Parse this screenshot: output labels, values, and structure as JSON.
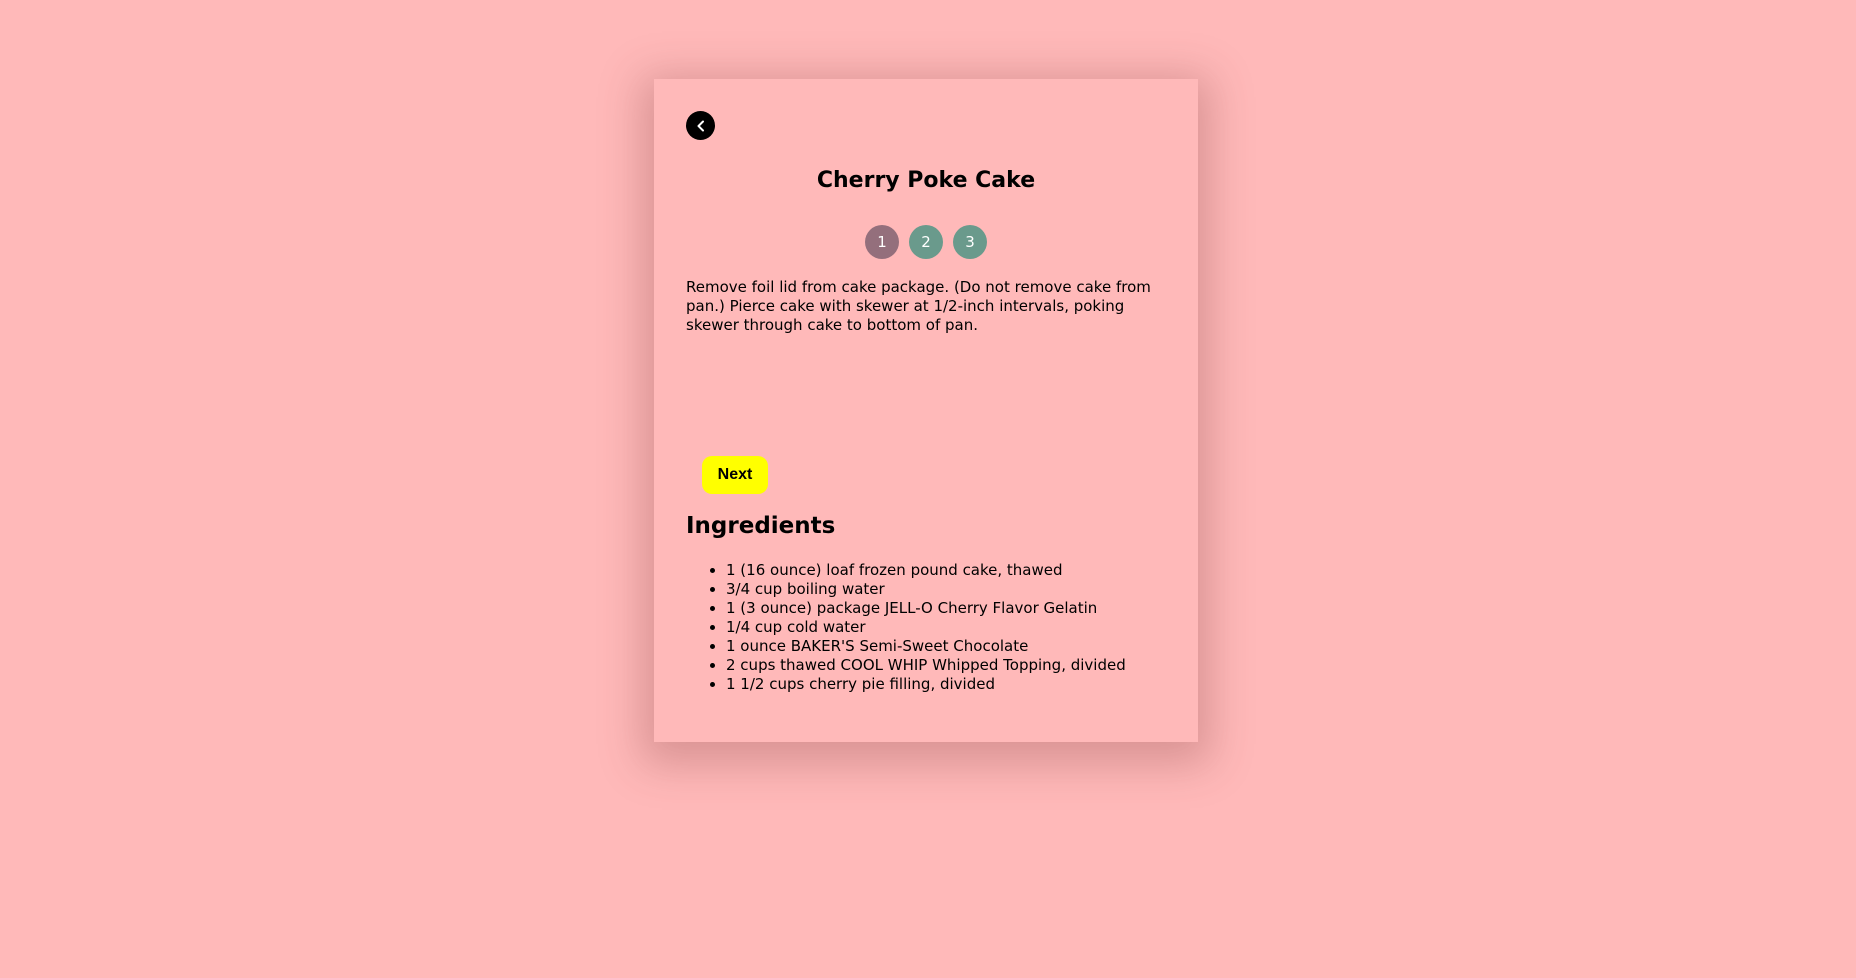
{
  "recipe": {
    "title": "Cherry Poke Cake"
  },
  "steps": {
    "items": [
      "1",
      "2",
      "3"
    ],
    "active": 1,
    "colors": {
      "active": "#946f7c",
      "inactive": "#6a9a8c"
    }
  },
  "instruction": {
    "text": "Remove foil lid from cake package. (Do not remove cake from pan.) Pierce cake with skewer at 1/2-inch intervals, poking skewer through cake to bottom of pan."
  },
  "actions": {
    "next_label": "Next",
    "back_icon": "chevron-left-icon"
  },
  "ingredients": {
    "heading": "Ingredients",
    "items": [
      "1 (16 ounce) loaf frozen pound cake, thawed",
      "3/4 cup boiling water",
      "1 (3 ounce) package JELL-O Cherry Flavor Gelatin",
      "1/4 cup cold water",
      "1 ounce BAKER'S Semi-Sweet Chocolate",
      "2 cups thawed COOL WHIP Whipped Topping, divided",
      "1 1/2 cups cherry pie filling, divided"
    ]
  },
  "theme": {
    "background": "#ffb9b9",
    "next_button": "#ffff00"
  }
}
